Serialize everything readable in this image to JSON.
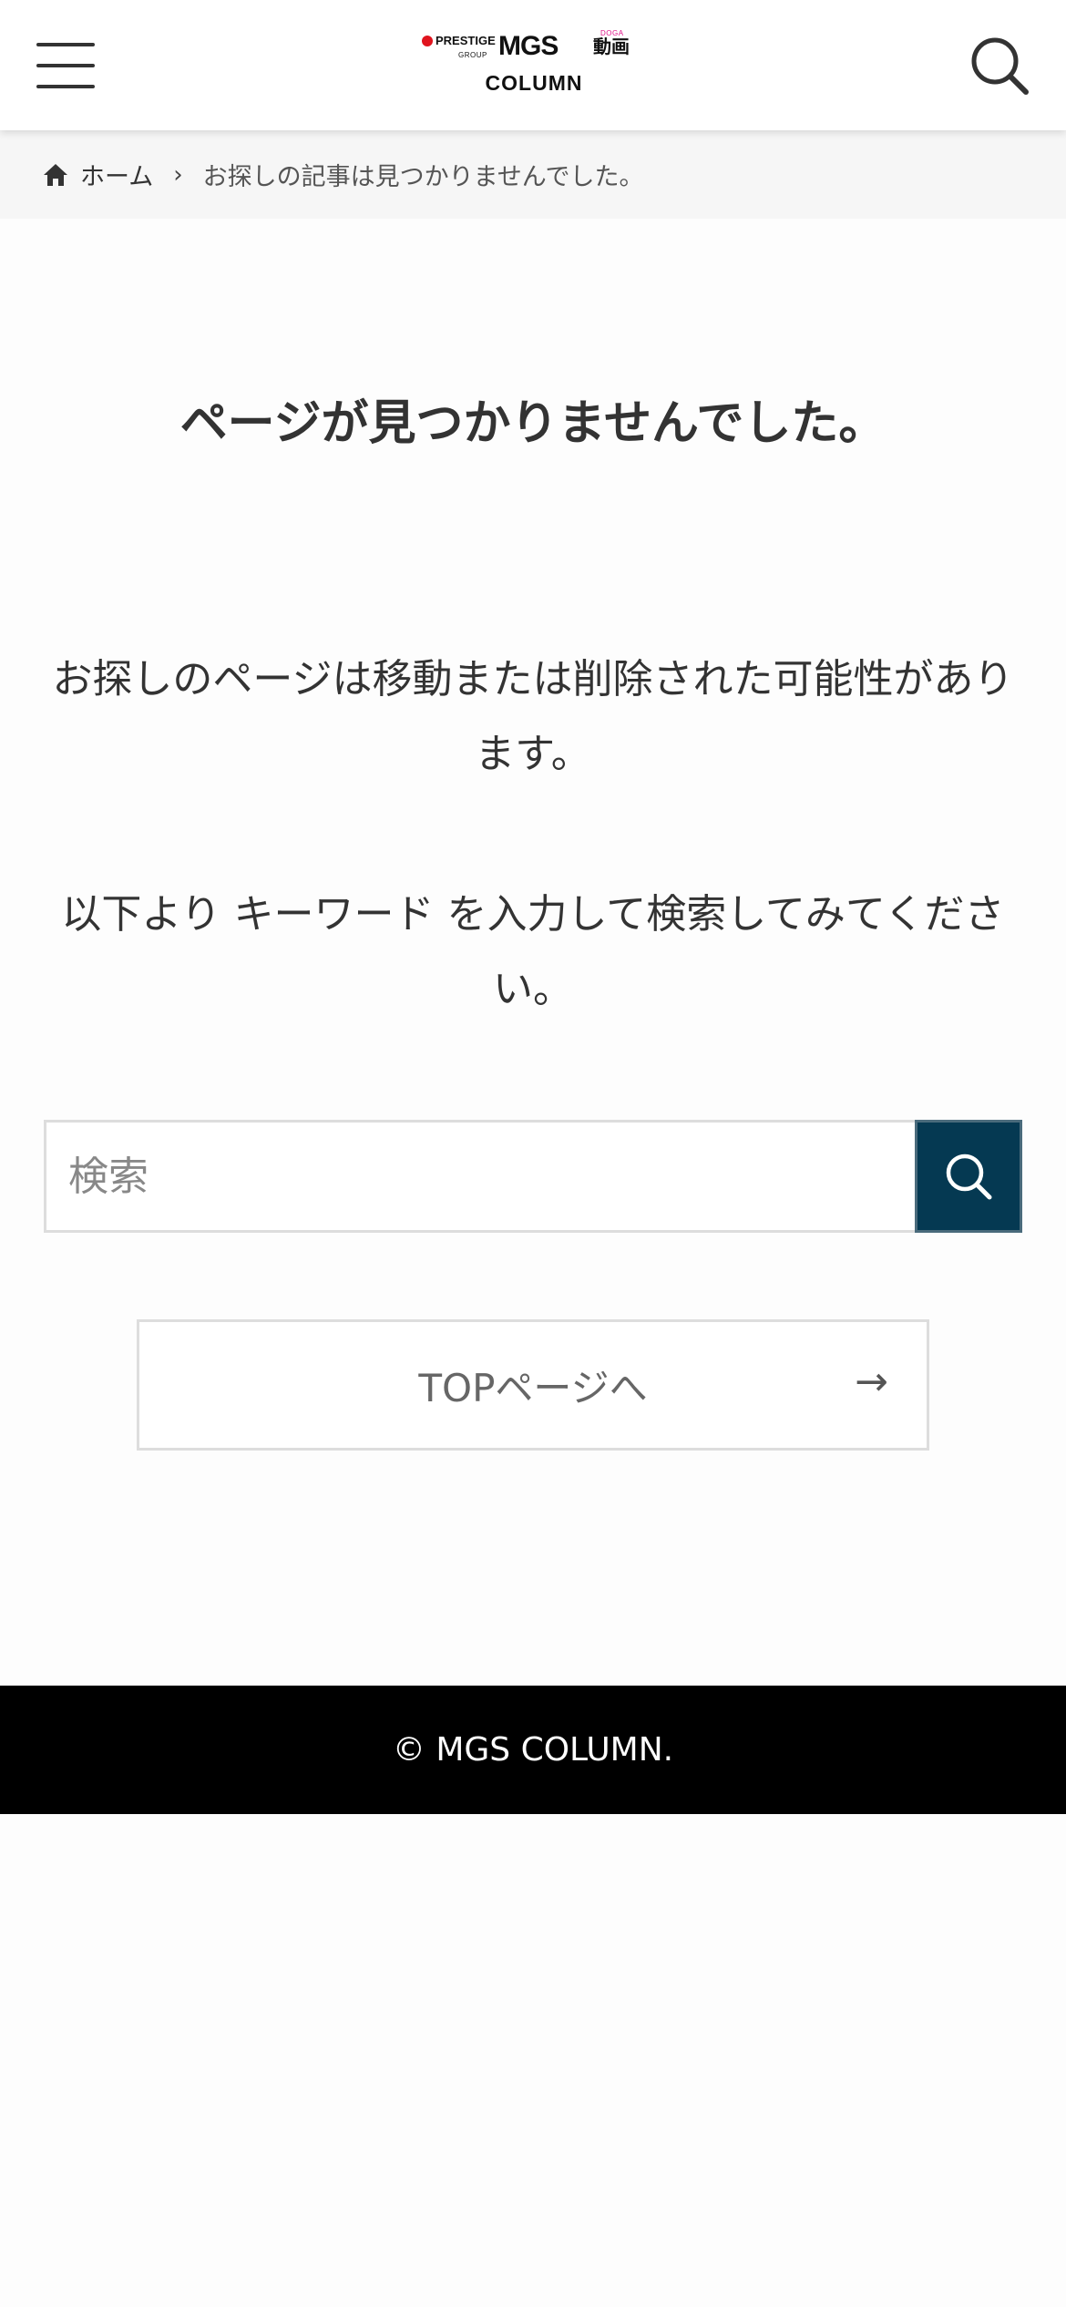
{
  "header": {
    "menu_icon": "hamburger-menu-icon",
    "search_icon": "search-icon",
    "logo": {
      "prestige": "PRESTIGE",
      "group": "GROUP",
      "mgs": "MGS",
      "douga": "動画",
      "douga_small": "DOGA",
      "column": "COLUMN"
    }
  },
  "breadcrumb": {
    "home_icon": "home-icon",
    "home_label": "ホーム",
    "separator": "›",
    "current": "お探しの記事は見つかりませんでした。"
  },
  "main": {
    "title": "ページが見つかりませんでした。",
    "message1": "お探しのページは移動または削除された可能性があります。",
    "message2": "以下より キーワード を入力して検索してみてください。",
    "search": {
      "placeholder": "検索",
      "button_icon": "search-icon"
    },
    "top_link": {
      "label": "TOPページへ",
      "arrow": "→"
    }
  },
  "footer": {
    "copyright": "© MGS COLUMN."
  },
  "colors": {
    "accent": "#053952",
    "footer_bg": "#000000",
    "breadcrumb_bg": "#f6f6f6",
    "logo_red": "#e0141e"
  }
}
